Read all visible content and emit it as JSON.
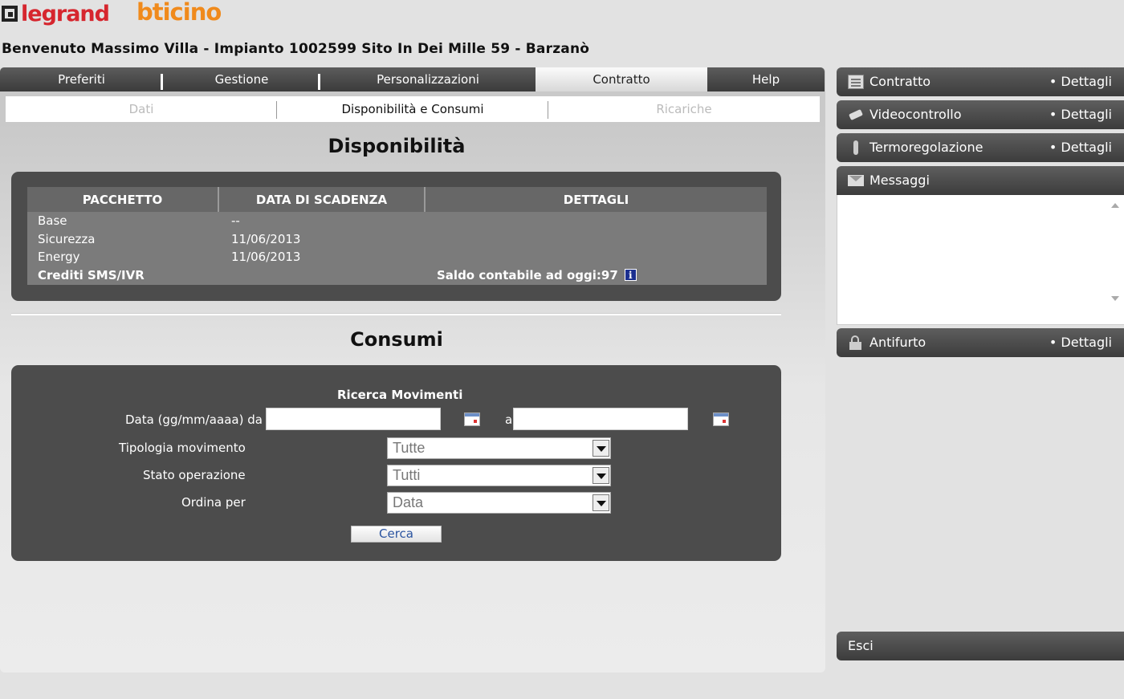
{
  "header": {
    "brand_legrand": "legrand",
    "brand_bticino": "bticino",
    "welcome": "Benvenuto Massimo Villa - Impianto 1002599 Sito In Dei Mille 59 - Barzanò"
  },
  "tabs": [
    {
      "label": "Preferiti"
    },
    {
      "label": "Gestione"
    },
    {
      "label": "Personalizzazioni"
    },
    {
      "label": "Contratto"
    },
    {
      "label": "Help"
    }
  ],
  "subtabs": [
    {
      "label": "Dati"
    },
    {
      "label": "Disponibilità e Consumi"
    },
    {
      "label": "Ricariche"
    }
  ],
  "disponibilita": {
    "title": "Disponibilità",
    "columns": [
      "PACCHETTO",
      "DATA DI SCADENZA",
      "DETTAGLI"
    ],
    "rows": [
      {
        "pacchetto": "Base",
        "scadenza": "--",
        "dettagli": ""
      },
      {
        "pacchetto": "Sicurezza",
        "scadenza": "11/06/2013",
        "dettagli": ""
      },
      {
        "pacchetto": "Energy",
        "scadenza": "11/06/2013",
        "dettagli": ""
      },
      {
        "pacchetto": "Crediti SMS/IVR",
        "scadenza": "",
        "dettagli": "Saldo contabile ad oggi:97"
      }
    ],
    "info_icon_glyph": "i"
  },
  "consumi": {
    "title": "Consumi",
    "form_title": "Ricerca Movimenti",
    "date_label": "Data (gg/mm/aaaa) da",
    "date_to_label": "a",
    "date_from_value": "",
    "date_to_value": "",
    "tipologia_label": "Tipologia movimento",
    "tipologia_value": "Tutte",
    "stato_label": "Stato operazione",
    "stato_value": "Tutti",
    "ordina_label": "Ordina per",
    "ordina_value": "Data",
    "search_button": "Cerca"
  },
  "sidebar": {
    "contratto": {
      "label": "Contratto",
      "details": "• Dettagli"
    },
    "videocontrollo": {
      "label": "Videocontrollo",
      "details": "• Dettagli"
    },
    "termoregolazione": {
      "label": "Termoregolazione",
      "details": "• Dettagli"
    },
    "messaggi": {
      "label": "Messaggi"
    },
    "antifurto": {
      "label": "Antifurto",
      "details": "• Dettagli"
    },
    "esci": {
      "label": "Esci"
    }
  }
}
